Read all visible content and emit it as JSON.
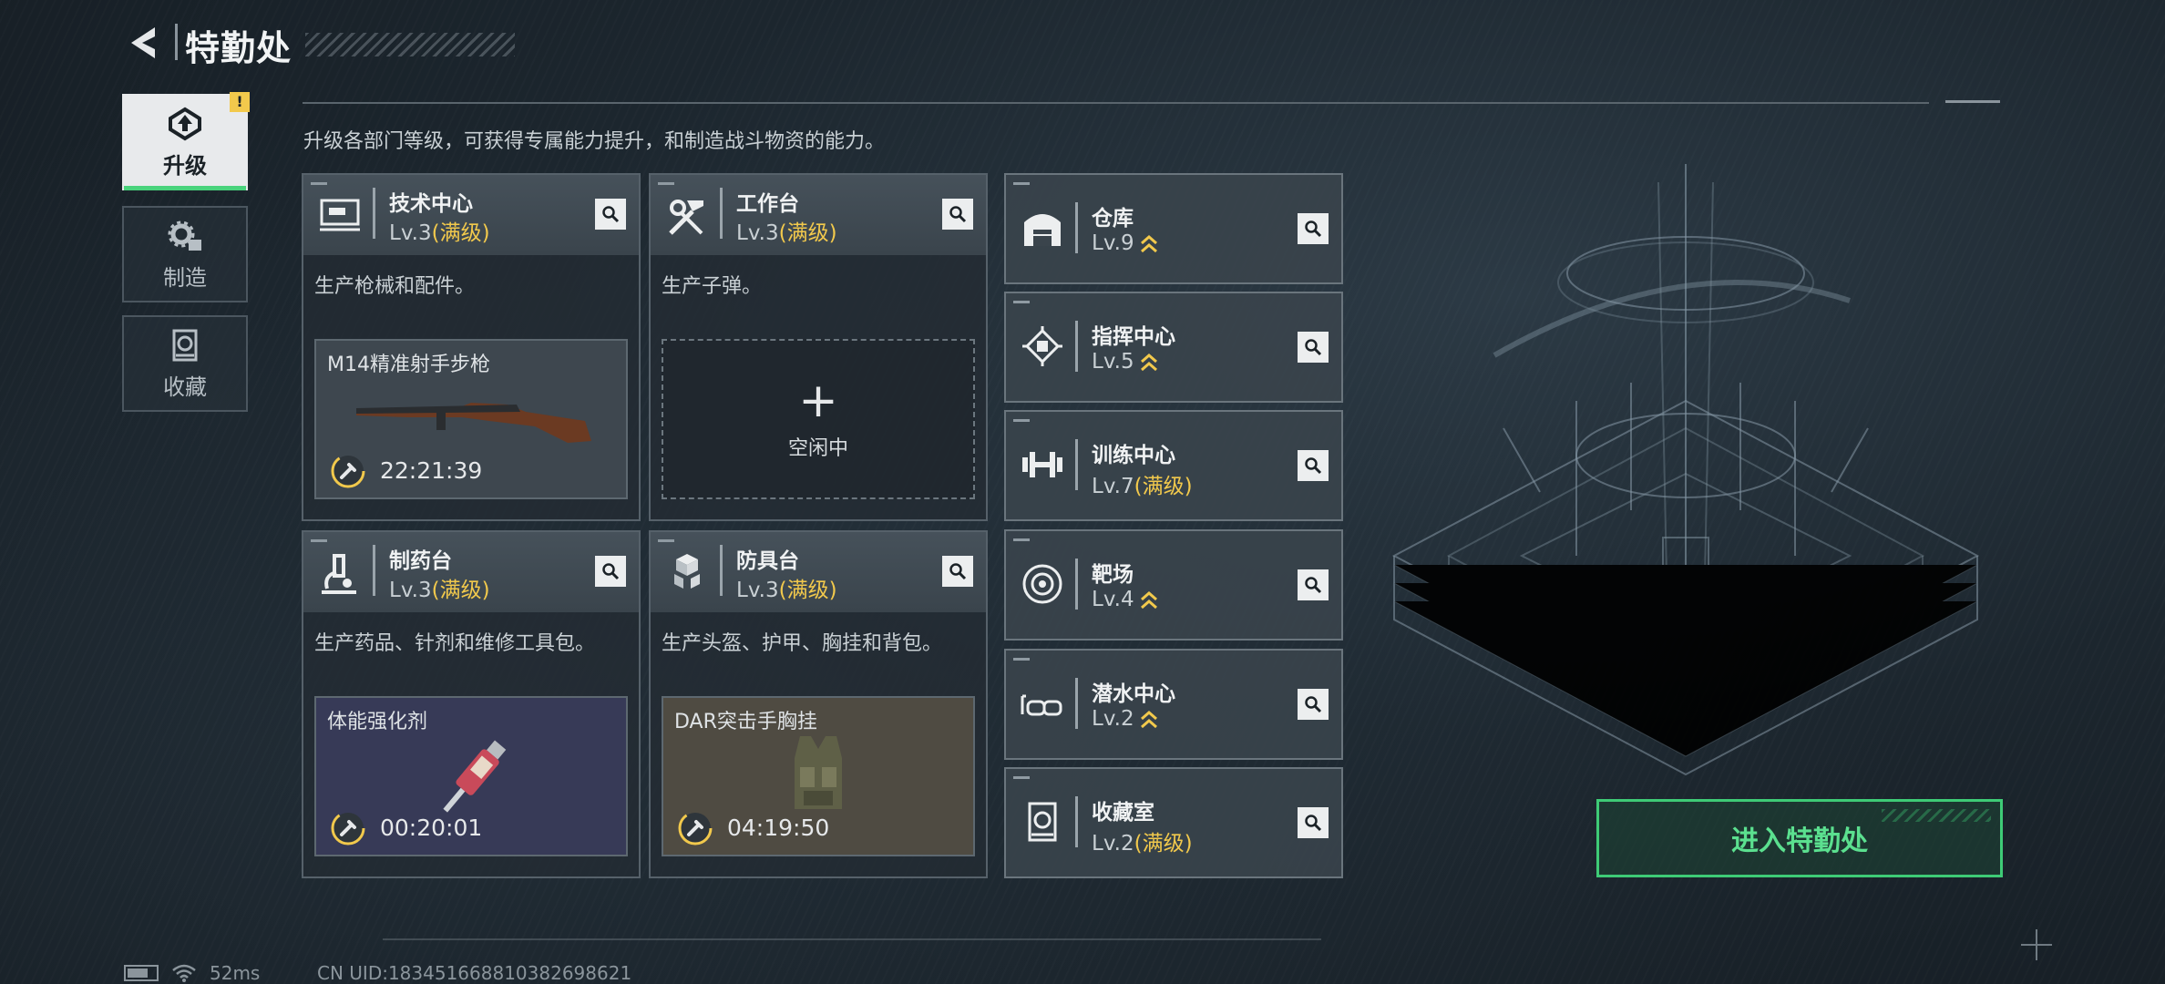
{
  "header": {
    "title": "特勤处"
  },
  "nav": [
    {
      "label": "升级",
      "icon": "upgrade-icon",
      "active": true,
      "badge": "!"
    },
    {
      "label": "制造",
      "icon": "gears-icon",
      "active": false
    },
    {
      "label": "收藏",
      "icon": "collection-icon",
      "active": false
    }
  ],
  "description": "升级各部门等级，可获得专属能力提升，和制造战斗物资的能力。",
  "departments": [
    {
      "name": "技术中心",
      "level": "Lv.3",
      "max_tag": "(满级)",
      "icon": "computer-icon",
      "desc": "生产枪械和配件。",
      "slot": {
        "item": "M14精准射手步枪",
        "timer": "22:21:39"
      }
    },
    {
      "name": "工作台",
      "level": "Lv.3",
      "max_tag": "(满级)",
      "icon": "tools-icon",
      "desc": "生产子弹。",
      "slot": {
        "idle": "空闲中"
      }
    },
    {
      "name": "制药台",
      "level": "Lv.3",
      "max_tag": "(满级)",
      "icon": "microscope-icon",
      "desc": "生产药品、针剂和维修工具包。",
      "slot": {
        "item": "体能强化剂",
        "timer": "00:20:01"
      }
    },
    {
      "name": "防具台",
      "level": "Lv.3",
      "max_tag": "(满级)",
      "icon": "armor-blocks-icon",
      "desc": "生产头盔、护甲、胸挂和背包。",
      "slot": {
        "item": "DAR突击手胸挂",
        "timer": "04:19:50"
      }
    }
  ],
  "facilities": [
    {
      "name": "仓库",
      "level": "Lv.9",
      "max_tag": "",
      "icon": "warehouse-icon",
      "upgradable": true
    },
    {
      "name": "指挥中心",
      "level": "Lv.5",
      "max_tag": "",
      "icon": "command-chip-icon",
      "upgradable": true
    },
    {
      "name": "训练中心",
      "level": "Lv.7",
      "max_tag": "(满级)",
      "icon": "dumbbell-icon",
      "upgradable": false
    },
    {
      "name": "靶场",
      "level": "Lv.4",
      "max_tag": "",
      "icon": "target-icon",
      "upgradable": true
    },
    {
      "name": "潜水中心",
      "level": "Lv.2",
      "max_tag": "",
      "icon": "diving-mask-icon",
      "upgradable": true
    },
    {
      "name": "收藏室",
      "level": "Lv.2",
      "max_tag": "(满级)",
      "icon": "collection-room-icon",
      "upgradable": false
    }
  ],
  "enter_button": "进入特勤处",
  "status": {
    "ping": "52ms",
    "uid": "CN UID:183451668810382698621"
  },
  "colors": {
    "accent_green": "#3ecb76",
    "max_level_gold": "#f2c94c",
    "warning": "#f2c94c"
  }
}
